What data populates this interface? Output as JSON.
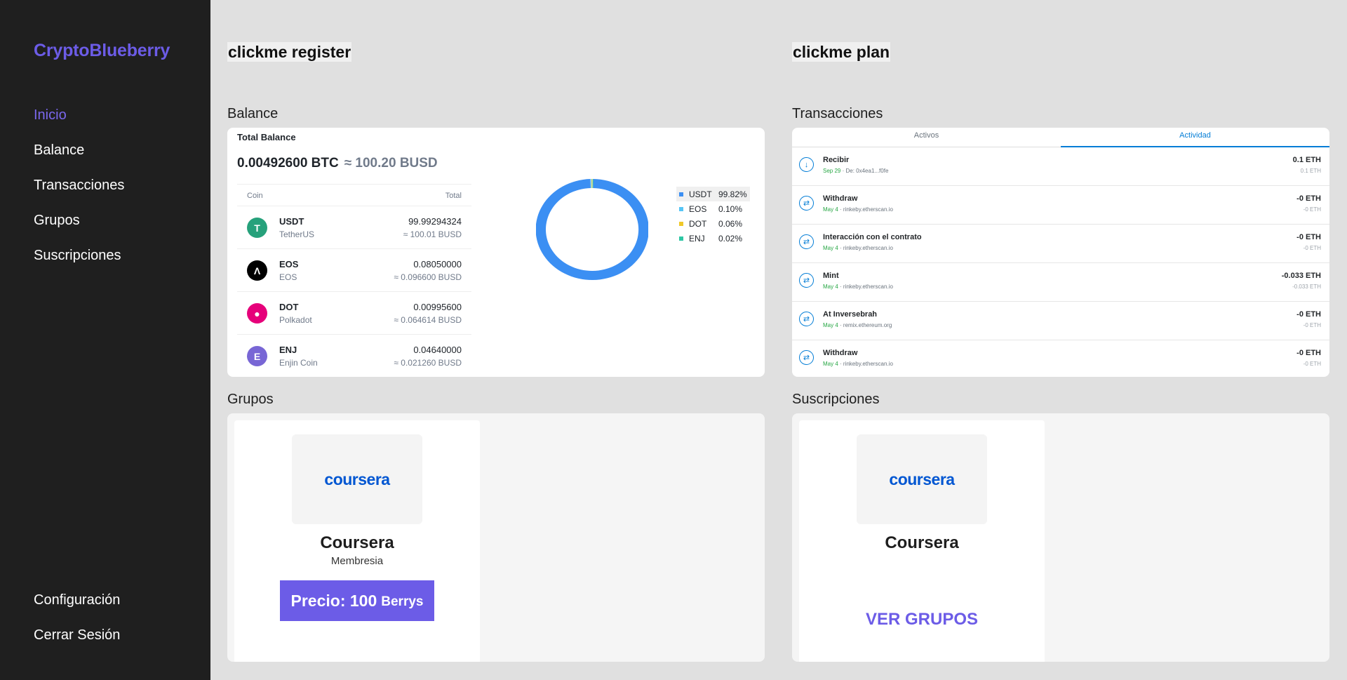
{
  "sidebar": {
    "brand": "CryptoBlueberry",
    "nav": [
      "Inicio",
      "Balance",
      "Transacciones",
      "Grupos",
      "Suscripciones"
    ],
    "active": "Inicio",
    "bottom": [
      "Configuración",
      "Cerrar Sesión"
    ]
  },
  "header": {
    "left_link": "clickme register",
    "right_link": "clickme plan"
  },
  "balance": {
    "section_title": "Balance",
    "label": "Total Balance",
    "btc": "0.00492600 BTC",
    "busd": "≈ 100.20 BUSD",
    "col_coin": "Coin",
    "col_total": "Total",
    "coins": [
      {
        "symbol": "USDT",
        "name": "TetherUS",
        "amount": "99.99294324",
        "busd": "≈ 100.01 BUSD",
        "icon": "tether-icon",
        "color": "#26a17b",
        "glyph": "T"
      },
      {
        "symbol": "EOS",
        "name": "EOS",
        "amount": "0.08050000",
        "busd": "≈ 0.096600 BUSD",
        "icon": "eos-icon",
        "color": "#000000",
        "glyph": "Λ"
      },
      {
        "symbol": "DOT",
        "name": "Polkadot",
        "amount": "0.00995600",
        "busd": "≈ 0.064614 BUSD",
        "icon": "polkadot-icon",
        "color": "#e6007a",
        "glyph": "●"
      },
      {
        "symbol": "ENJ",
        "name": "Enjin Coin",
        "amount": "0.04640000",
        "busd": "≈ 0.021260 BUSD",
        "icon": "enjin-icon",
        "color": "#7866d5",
        "glyph": "E"
      }
    ],
    "legend": [
      {
        "name": "USDT",
        "pct": "99.82%",
        "value": 99.82,
        "color": "#3b8ff3"
      },
      {
        "name": "EOS",
        "pct": "0.10%",
        "value": 0.1,
        "color": "#56c5f5"
      },
      {
        "name": "DOT",
        "pct": "0.06%",
        "value": 0.06,
        "color": "#f0c929"
      },
      {
        "name": "ENJ",
        "pct": "0.02%",
        "value": 0.02,
        "color": "#2ec7a4"
      }
    ]
  },
  "transactions": {
    "section_title": "Transacciones",
    "tabs": [
      "Activos",
      "Actividad"
    ],
    "active_tab": "Actividad",
    "rows": [
      {
        "title": "Recibir",
        "date": "Sep 29",
        "sep": " · ",
        "sub": "De: 0x4ea1...f0fe",
        "amount": "0.1 ETH",
        "amount2": "0.1 ETH",
        "icon": "receive-icon"
      },
      {
        "title": "Withdraw",
        "date": "May 4",
        "sep": " · ",
        "sub": "rinkeby.etherscan.io",
        "amount": "-0 ETH",
        "amount2": "-0 ETH",
        "icon": "swap-icon"
      },
      {
        "title": "Interacción con el contrato",
        "date": "May 4",
        "sep": " · ",
        "sub": "rinkeby.etherscan.io",
        "amount": "-0 ETH",
        "amount2": "-0 ETH",
        "icon": "swap-icon"
      },
      {
        "title": "Mint",
        "date": "May 4",
        "sep": " · ",
        "sub": "rinkeby.etherscan.io",
        "amount": "-0.033 ETH",
        "amount2": "-0.033 ETH",
        "icon": "swap-icon"
      },
      {
        "title": "At Inversebrah",
        "date": "May 4",
        "sep": " · ",
        "sub": "remix.ethereum.org",
        "amount": "-0 ETH",
        "amount2": "-0 ETH",
        "icon": "swap-icon"
      },
      {
        "title": "Withdraw",
        "date": "May 4",
        "sep": " · ",
        "sub": "rinkeby.etherscan.io",
        "amount": "-0 ETH",
        "amount2": "-0 ETH",
        "icon": "swap-icon"
      }
    ]
  },
  "grupos": {
    "section_title": "Grupos",
    "card": {
      "logo": "coursera",
      "title": "Coursera",
      "subtitle": "Membresia",
      "price_main": "Precio: 100",
      "price_unit": "Berrys"
    }
  },
  "suscripciones": {
    "section_title": "Suscripciones",
    "card": {
      "logo": "coursera",
      "title": "Coursera",
      "button": "VER GRUPOS"
    }
  },
  "colors": {
    "accent": "#6c5ce7",
    "sidebar_bg": "#1f1f1f",
    "page_bg": "#e0e0e0",
    "metamask_blue": "#037dd6"
  }
}
